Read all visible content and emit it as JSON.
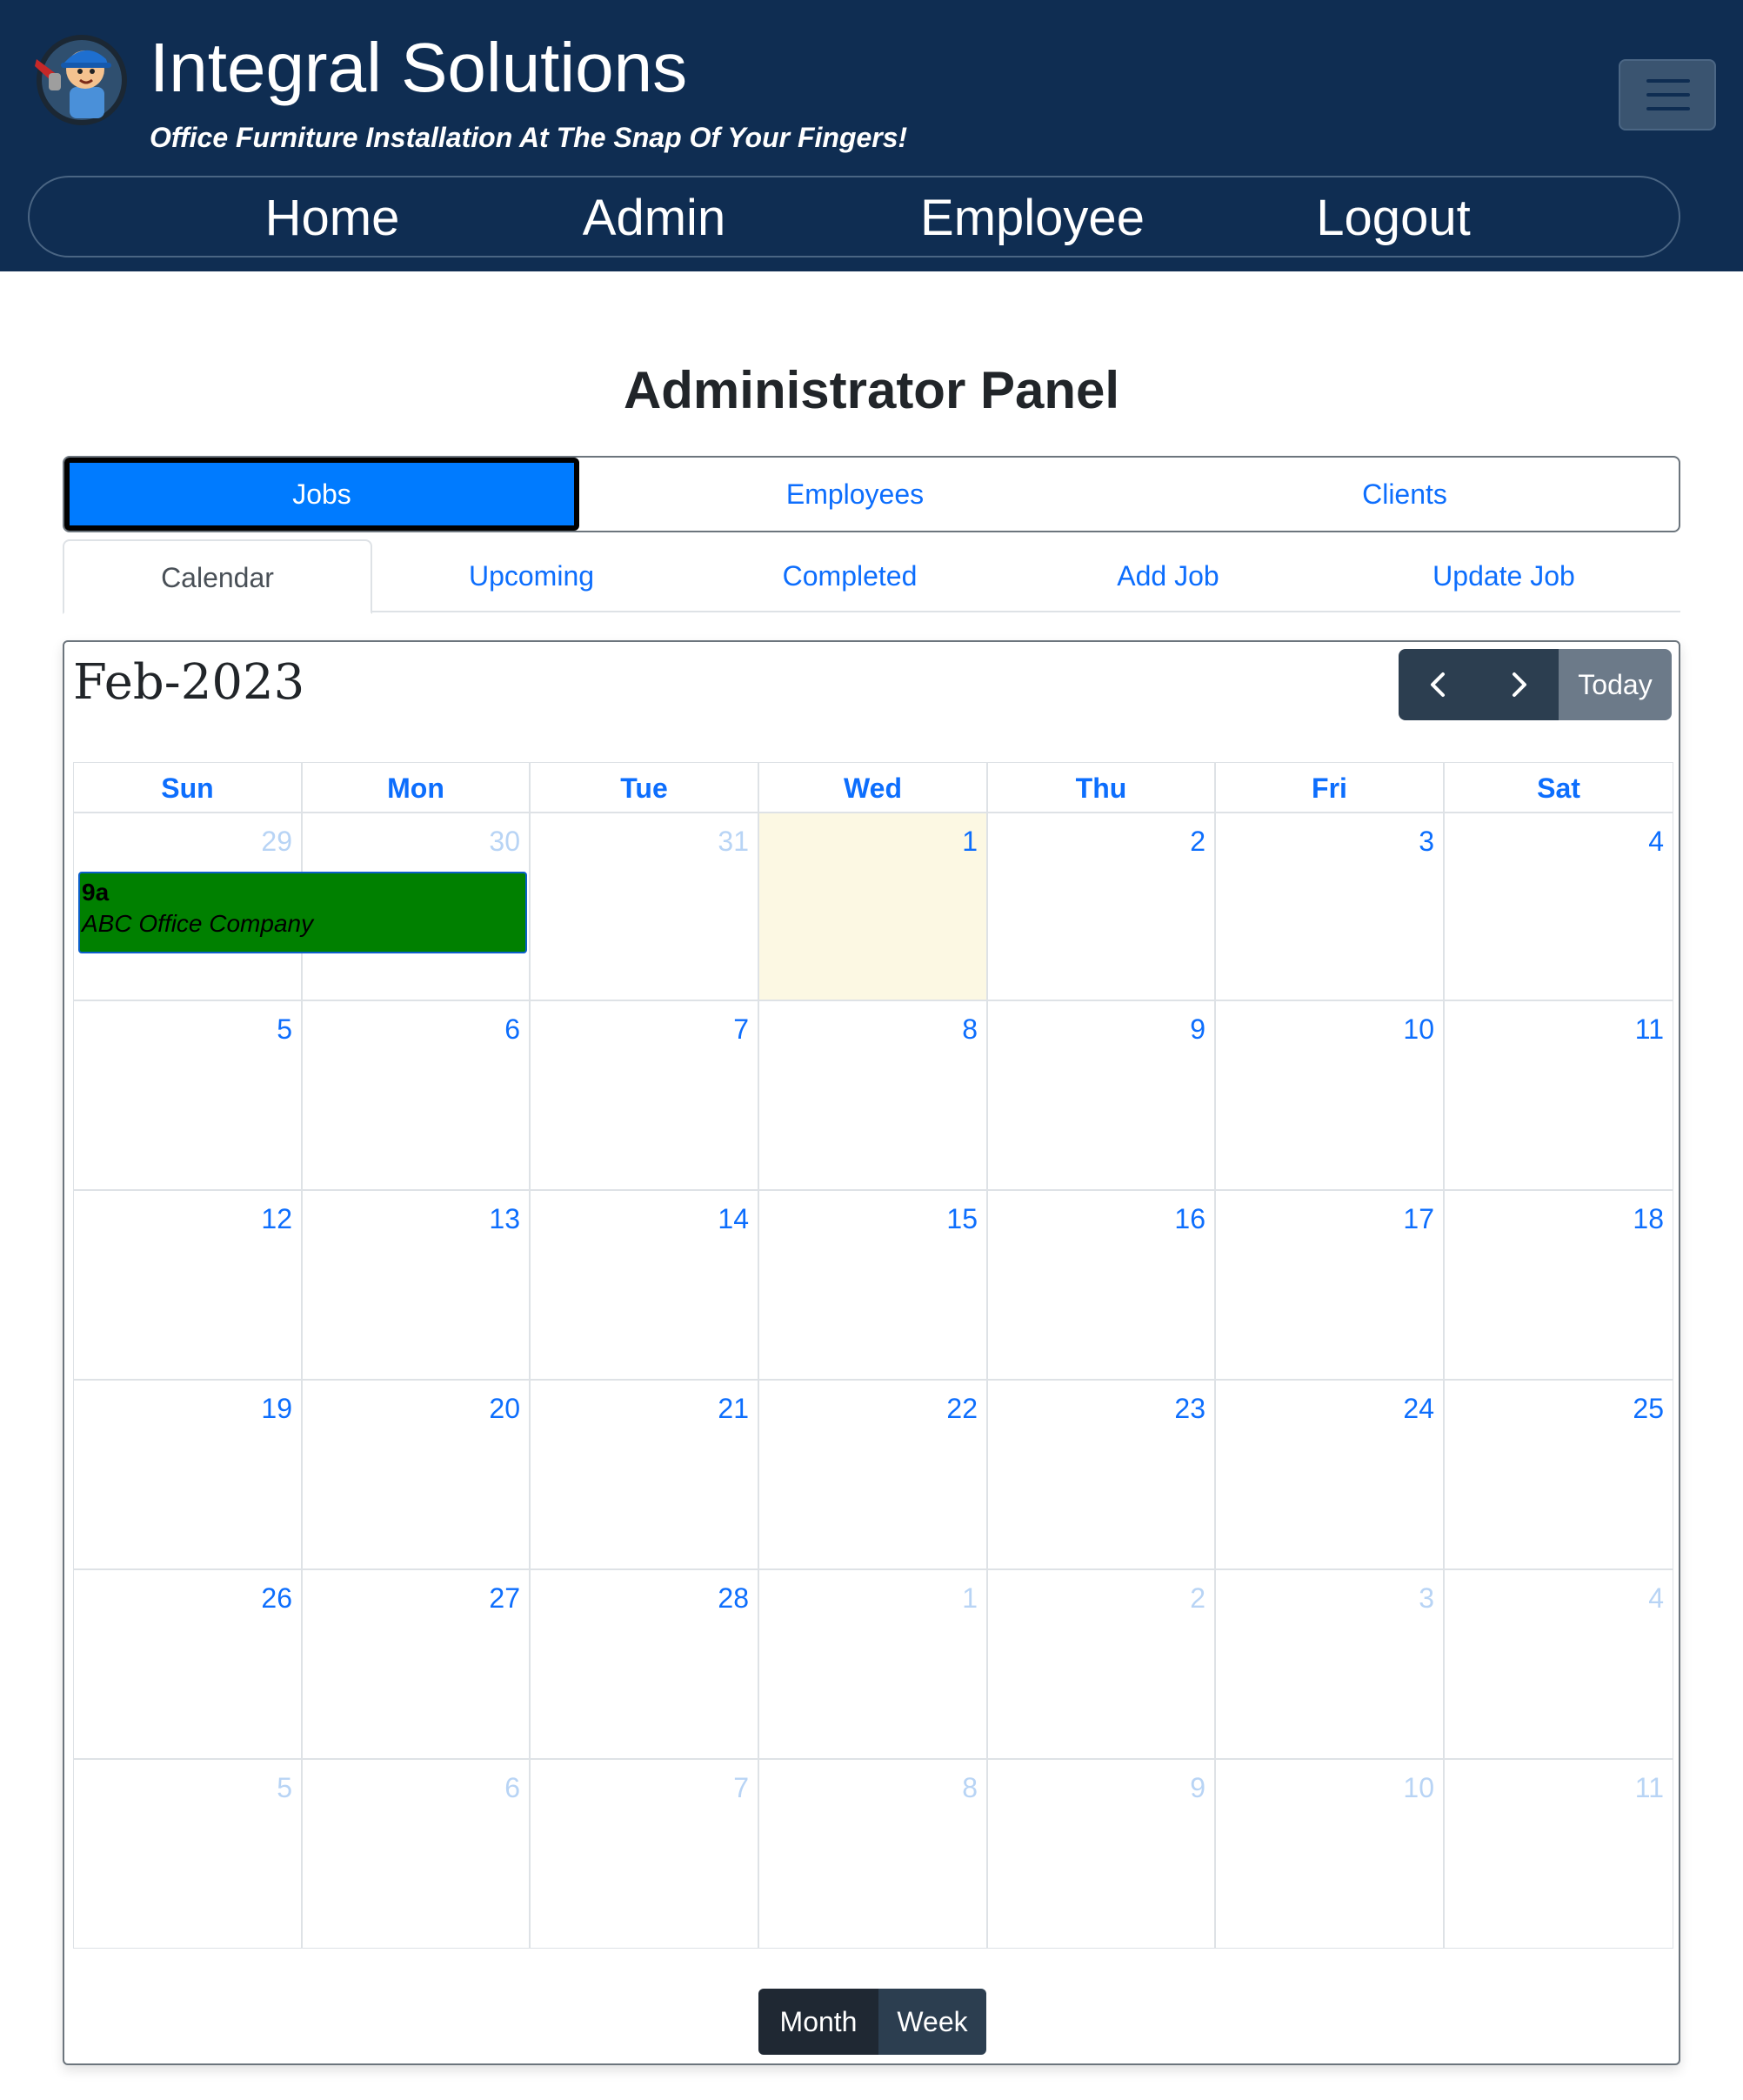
{
  "brand": {
    "title": "Integral Solutions",
    "tagline": "Office Furniture Installation At The Snap Of Your Fingers!"
  },
  "nav": {
    "items": [
      "Home",
      "Admin",
      "Employee",
      "Logout"
    ]
  },
  "panel": {
    "title": "Administrator Panel",
    "tabs": [
      "Jobs",
      "Employees",
      "Clients"
    ],
    "active_tab": "Jobs",
    "subtabs": [
      "Calendar",
      "Upcoming",
      "Completed",
      "Add Job",
      "Update Job"
    ],
    "active_subtab": "Calendar"
  },
  "calendar": {
    "title": "Feb-2023",
    "today_label": "Today",
    "weekdays": [
      "Sun",
      "Mon",
      "Tue",
      "Wed",
      "Thu",
      "Fri",
      "Sat"
    ],
    "weeks": [
      [
        {
          "d": "29",
          "other": true
        },
        {
          "d": "30",
          "other": true
        },
        {
          "d": "31",
          "other": true
        },
        {
          "d": "1",
          "today": true
        },
        {
          "d": "2"
        },
        {
          "d": "3"
        },
        {
          "d": "4"
        }
      ],
      [
        {
          "d": "5"
        },
        {
          "d": "6"
        },
        {
          "d": "7"
        },
        {
          "d": "8"
        },
        {
          "d": "9"
        },
        {
          "d": "10"
        },
        {
          "d": "11"
        }
      ],
      [
        {
          "d": "12"
        },
        {
          "d": "13"
        },
        {
          "d": "14"
        },
        {
          "d": "15"
        },
        {
          "d": "16"
        },
        {
          "d": "17"
        },
        {
          "d": "18"
        }
      ],
      [
        {
          "d": "19"
        },
        {
          "d": "20"
        },
        {
          "d": "21"
        },
        {
          "d": "22"
        },
        {
          "d": "23"
        },
        {
          "d": "24"
        },
        {
          "d": "25"
        }
      ],
      [
        {
          "d": "26"
        },
        {
          "d": "27"
        },
        {
          "d": "28"
        },
        {
          "d": "1",
          "other": true
        },
        {
          "d": "2",
          "other": true
        },
        {
          "d": "3",
          "other": true
        },
        {
          "d": "4",
          "other": true
        }
      ],
      [
        {
          "d": "5",
          "other": true
        },
        {
          "d": "6",
          "other": true
        },
        {
          "d": "7",
          "other": true
        },
        {
          "d": "8",
          "other": true
        },
        {
          "d": "9",
          "other": true
        },
        {
          "d": "10",
          "other": true
        },
        {
          "d": "11",
          "other": true
        }
      ]
    ],
    "event": {
      "time": "9a",
      "title": "ABC Office Company",
      "color": "#008000"
    },
    "views": [
      "Month",
      "Week"
    ],
    "active_view": "Month"
  },
  "colors": {
    "header_bg": "#0f2d52",
    "accent": "#0d6efd",
    "today_bg": "#fcf8e3"
  }
}
